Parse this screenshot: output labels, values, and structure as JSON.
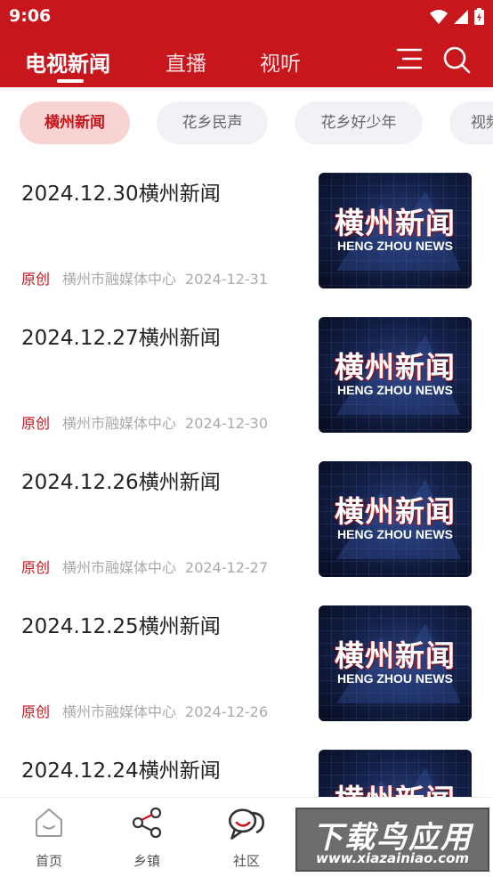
{
  "status_bar": {
    "time": "9:06"
  },
  "nav": {
    "tabs": [
      {
        "label": "电视新闻",
        "active": true
      },
      {
        "label": "直播",
        "active": false
      },
      {
        "label": "视听",
        "active": false
      }
    ],
    "icons": [
      "menu-icon",
      "search-icon"
    ]
  },
  "categories": [
    {
      "label": "横州新闻",
      "active": true
    },
    {
      "label": "花乡民声",
      "active": false
    },
    {
      "label": "花乡好少年",
      "active": false
    },
    {
      "label": "视频",
      "active": false
    }
  ],
  "news": [
    {
      "title": "2024.12.30横州新闻",
      "tag": "原创",
      "source": "横州市融媒体中心",
      "date": "2024-12-31"
    },
    {
      "title": "2024.12.27横州新闻",
      "tag": "原创",
      "source": "横州市融媒体中心",
      "date": "2024-12-30"
    },
    {
      "title": "2024.12.26横州新闻",
      "tag": "原创",
      "source": "横州市融媒体中心",
      "date": "2024-12-27"
    },
    {
      "title": "2024.12.25横州新闻",
      "tag": "原创",
      "source": "横州市融媒体中心",
      "date": "2024-12-26"
    },
    {
      "title": "2024.12.24横州新闻"
    }
  ],
  "thumbnail": {
    "title": "横州新闻",
    "subtitle": "HENG ZHOU NEWS"
  },
  "tabbar": {
    "items": [
      {
        "label": "首页",
        "icon": "home-icon"
      },
      {
        "label": "乡镇",
        "icon": "share-icon"
      },
      {
        "label": "社区",
        "icon": "chat-icon"
      }
    ]
  },
  "watermark": {
    "text": "下载鸟应用",
    "url": "www.xiazainiao.com"
  },
  "colors": {
    "brand": "#c8161d",
    "chip_active_bg": "#f7d3d3",
    "chip_bg": "#f1f2f5"
  }
}
